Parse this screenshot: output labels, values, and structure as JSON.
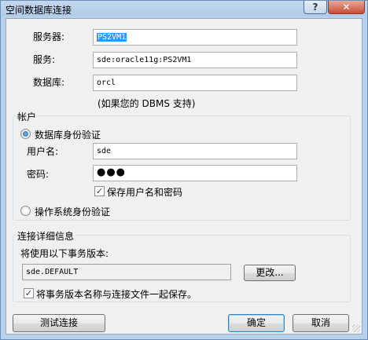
{
  "window": {
    "title": "空间数据库连接",
    "help_glyph": "?",
    "close_glyph": "✕"
  },
  "connection": {
    "server_label": "服务器:",
    "server_value": "PS2VM1",
    "service_label": "服务:",
    "service_value": "sde:oracle11g:PS2VM1",
    "database_label": "数据库:",
    "database_value": "orcl",
    "database_hint": "(如果您的 DBMS 支持)"
  },
  "account": {
    "legend": "帐户",
    "db_auth_label": "数据库身份验证",
    "db_auth_selected": true,
    "username_label": "用户名:",
    "username_value": "sde",
    "password_label": "密码:",
    "password_value": "●●●",
    "save_credentials_label": "保存用户名和密码",
    "save_credentials_checked": true,
    "os_auth_label": "操作系统身份验证",
    "os_auth_selected": false
  },
  "details": {
    "legend": "连接详细信息",
    "version_label": "将使用以下事务版本:",
    "version_value": "sde.DEFAULT",
    "change_label": "更改...",
    "save_version_label": "将事务版本名称与连接文件一起保存。",
    "save_version_checked": true
  },
  "footer": {
    "test_label": "测试连接",
    "ok_label": "确定",
    "cancel_label": "取消"
  },
  "check_glyph": "✓"
}
